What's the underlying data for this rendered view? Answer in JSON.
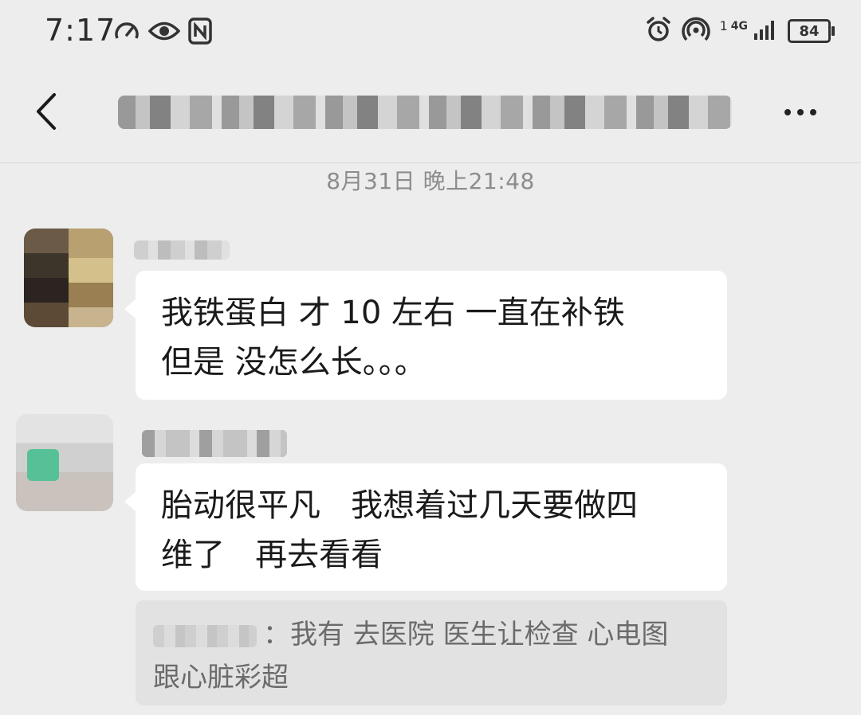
{
  "status_bar": {
    "time": "7:17",
    "battery": "84",
    "network": "4G",
    "signal_slot": "1",
    "left_icons": [
      "speed-icon",
      "eye-icon",
      "nfc-icon"
    ],
    "right_icons": [
      "alarm-icon",
      "hotspot-icon",
      "signal-icon",
      "battery-icon"
    ]
  },
  "nav_bar": {
    "title": "",
    "back_icon": "chevron-left-icon",
    "more_icon": "more-dots-icon"
  },
  "chat": {
    "timestamp": "8月31日 晚上21:48",
    "messages": [
      {
        "sender": "",
        "lines": [
          "我铁蛋白 才 10 左右 一直在补铁",
          "但是 没怎么长。。。"
        ]
      },
      {
        "sender": "",
        "lines": [
          "胎动很平凡   我想着过几天要做四",
          "维了   再去看看"
        ],
        "quote": {
          "sender": "",
          "separator": "：",
          "lines": [
            "我有 去医院 医生让检查 心电图",
            "跟心脏彩超"
          ]
        }
      }
    ]
  },
  "colors": {
    "background": "#ededed",
    "bubble": "#ffffff",
    "quote_bg": "#e2e2e2",
    "timestamp": "#8c8c8c"
  }
}
